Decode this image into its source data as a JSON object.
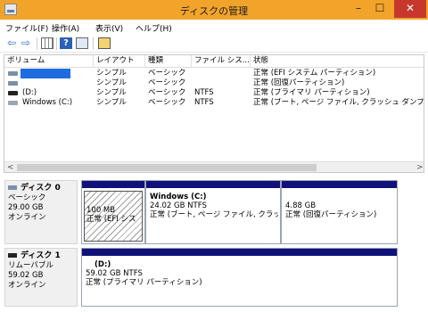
{
  "window": {
    "title": "ディスクの管理",
    "minimize_glyph": "–",
    "maximize_glyph": "☐",
    "close_glyph": "✕"
  },
  "menu": [
    "ファイル(F)",
    "操作(A)",
    "表示(V)",
    "ヘルプ(H)"
  ],
  "toolbar": {
    "back_glyph": "⇦",
    "forward_glyph": "⇨",
    "help_glyph": "?"
  },
  "volume_list": {
    "columns": [
      "ボリューム",
      "レイアウト",
      "種類",
      "ファイル シス...",
      "状態"
    ],
    "rows": [
      {
        "volume": "",
        "layout": "シンプル",
        "type": "ベーシック",
        "fs": "",
        "status": "正常 (EFI システム パーティション)"
      },
      {
        "volume": "",
        "layout": "シンプル",
        "type": "ベーシック",
        "fs": "",
        "status": "正常 (回復パーティション)"
      },
      {
        "volume": "(D:)",
        "layout": "シンプル",
        "type": "ベーシック",
        "fs": "NTFS",
        "status": "正常 (プライマリ パーティション)"
      },
      {
        "volume": "Windows (C:)",
        "layout": "シンプル",
        "type": "ベーシック",
        "fs": "NTFS",
        "status": "正常 (ブート, ページ ファイル, クラッシュ ダンプ, Wim"
      }
    ],
    "scroll_left": "<",
    "scroll_right": ">"
  },
  "disks": [
    {
      "name": "ディスク 0",
      "kind": "ベーシック",
      "size": "29.00 GB",
      "state": "オンライン",
      "partitions": [
        {
          "title": "",
          "size": "100 MB",
          "status": "正常 (EFI シス"
        },
        {
          "title": "Windows  (C:)",
          "size": "24.02 GB NTFS",
          "status": "正常 (ブート, ページ ファイル, クラッシュ"
        },
        {
          "title": "",
          "size": "4.88 GB",
          "status": "正常 (回復パーティション)"
        }
      ]
    },
    {
      "name": "ディスク 1",
      "kind": "リムーバブル",
      "size": "59.02 GB",
      "state": "オンライン",
      "partitions": [
        {
          "title": "(D:)",
          "size": "59.02 GB NTFS",
          "status": "正常 (プライマリ パーティション)"
        }
      ]
    }
  ],
  "colors": {
    "titlebar": "#f2a42a",
    "close": "#c7372b",
    "partition_header": "#10127a",
    "selected_volume": "#1e6de0"
  }
}
